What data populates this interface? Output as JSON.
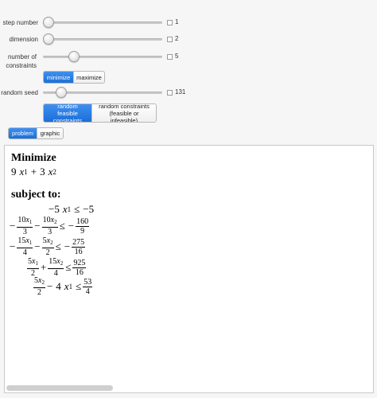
{
  "controls": {
    "step_number": {
      "label": "step number",
      "value": "1",
      "fraction": 0.0
    },
    "dimension": {
      "label": "dimension",
      "value": "2",
      "fraction": 0.0
    },
    "number_of_constraints": {
      "label": "number of constraints",
      "value": "5",
      "fraction": 0.25
    },
    "random_seed": {
      "label": "random seed",
      "value": "131",
      "fraction": 0.13
    }
  },
  "objective_mode": {
    "options": [
      "minimize",
      "maximize"
    ],
    "selected": "minimize"
  },
  "constraint_mode": {
    "options": [
      "random feasible constraints",
      "random constraints (feasible or infeasible)"
    ],
    "selected": "random feasible constraints"
  },
  "view_tabs": {
    "options": [
      "problem",
      "graphic"
    ],
    "selected": "problem"
  },
  "problem": {
    "objective_heading": "Minimize",
    "objective": {
      "c1": "9",
      "c2": "3",
      "var": "x",
      "op": "+"
    },
    "subject_heading": "subject to:",
    "c1": {
      "lhs": "−5",
      "rel": "≤",
      "rhs": "−5"
    },
    "c2": {
      "a": "10",
      "b": "3",
      "c": "10",
      "d": "3",
      "rhs_num": "160",
      "rhs_den": "9"
    },
    "c3": {
      "a": "15",
      "b": "4",
      "c": "5",
      "d": "2",
      "rhs_num": "275",
      "rhs_den": "16"
    },
    "c4": {
      "a": "5",
      "b": "2",
      "c": "15",
      "d": "4",
      "rhs_num": "925",
      "rhs_den": "16"
    },
    "c5": {
      "a": "5",
      "b": "2",
      "coef": "4",
      "rhs_num": "53",
      "rhs_den": "4"
    }
  },
  "colors": {
    "accent": "#1f73dd",
    "panel_border": "#c9c9c9",
    "background": "#f6f6f6"
  }
}
